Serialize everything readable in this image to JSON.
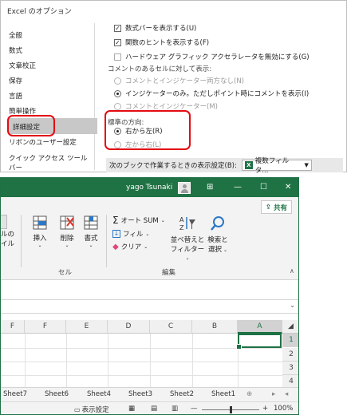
{
  "dialog": {
    "title": "Excel のオプション",
    "categories": [
      "全般",
      "数式",
      "文章校正",
      "保存",
      "言語",
      "簡単操作",
      "詳細設定",
      "リボンのユーザー設定",
      "クイック アクセス ツール バー"
    ],
    "selected_category": "詳細設定",
    "options": {
      "formula_bar": "数式バーを表示する(U)",
      "function_tips": "関数のヒントを表示する(F)",
      "hw_accel": "ハードウェア グラフィック アクセラレータを無効にする(G)",
      "comments_header": "コメントのあるセルに対して表示:",
      "comment_none": "コメントとインジケーター両方なし(N)",
      "comment_indicator": "インジケーターのみ。ただしポイント時にコメントを表示(I)",
      "comment_both": "コメントとインジケーター(M)",
      "direction_header": "標準の方向:",
      "rtl": "右から左(R)",
      "ltr": "左から右(L)"
    },
    "next_workbook_label": "次のブックで作業するときの表示設定(B):",
    "next_workbook_value": "複数フィルタ..."
  },
  "excel": {
    "user": "yago Tsunaki",
    "share": "共有",
    "ribbon": {
      "cut_label_1": "ルの",
      "cut_label_2": "イル",
      "insert": "挿入",
      "delete": "削除",
      "format": "書式",
      "cells_group": "セル",
      "autosum": "オート SUM",
      "fill": "フィル",
      "clear": "クリア",
      "sort": "並べ替えと",
      "sort2": "フィルター",
      "find": "検索と",
      "find2": "選択",
      "edit_group": "編集"
    },
    "columns": [
      "F",
      "E",
      "D",
      "C",
      "B",
      "A"
    ],
    "rows": [
      "1",
      "2",
      "3",
      "4"
    ],
    "sheets": [
      "Sheet7",
      "Sheet6",
      "Sheet4",
      "Sheet3",
      "Sheet2",
      "Sheet1"
    ],
    "status": {
      "display_settings": "表示設定",
      "zoom": "100%"
    }
  },
  "colors": {
    "excel_green": "#1f7244",
    "highlight_red": "#e30b13"
  }
}
